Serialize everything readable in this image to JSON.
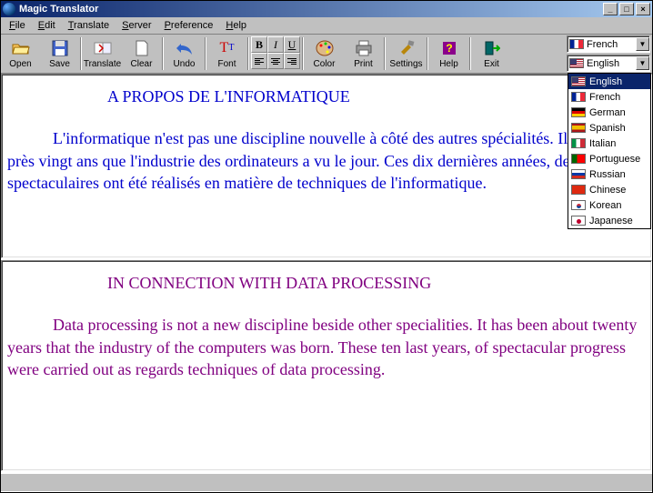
{
  "title": "Magic Translator",
  "menus": [
    "File",
    "Edit",
    "Translate",
    "Server",
    "Preference",
    "Help"
  ],
  "toolbar": {
    "open": "Open",
    "save": "Save",
    "translate": "Translate",
    "clear": "Clear",
    "undo": "Undo",
    "font": "Font",
    "color": "Color",
    "print": "Print",
    "settings": "Settings",
    "help": "Help",
    "exit": "Exit"
  },
  "format_buttons": {
    "bold": "B",
    "italic": "I",
    "underline": "U"
  },
  "lang_from": "French",
  "lang_to": "English",
  "languages": [
    {
      "label": "English",
      "flag": "us",
      "selected": true
    },
    {
      "label": "French",
      "flag": "fr"
    },
    {
      "label": "German",
      "flag": "de"
    },
    {
      "label": "Spanish",
      "flag": "es"
    },
    {
      "label": "Italian",
      "flag": "it"
    },
    {
      "label": "Portuguese",
      "flag": "pt"
    },
    {
      "label": "Russian",
      "flag": "ru"
    },
    {
      "label": "Chinese",
      "flag": "cn"
    },
    {
      "label": "Korean",
      "flag": "kr"
    },
    {
      "label": "Japanese",
      "flag": "jp"
    }
  ],
  "source": {
    "title": "A PROPOS DE L'INFORMATIQUE",
    "body": "L'informatique n'est pas une discipline nouvelle à côté des autres spécialités.   Il y a à peu près vingt ans que l'industrie des ordinateurs a vu le jour.   Ces dix dernières années, des progrès spectaculaires ont été réalisés en matière de techniques de l'informatique."
  },
  "target": {
    "title": "IN CONNECTION WITH DATA PROCESSING",
    "body": "Data processing is not a new discipline beside other specialities. It has been about twenty years that the industry of the computers was born. These ten last years, of spectacular progress were carried out as regards techniques of data processing."
  }
}
